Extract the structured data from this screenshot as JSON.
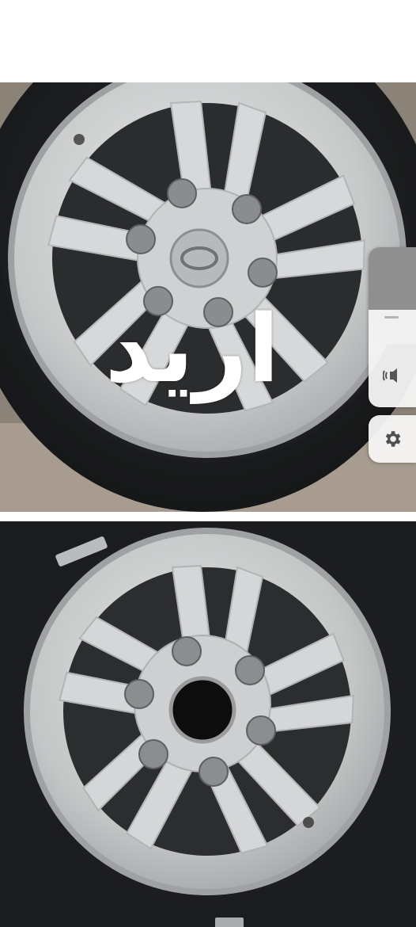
{
  "overlay": {
    "text": "اريد",
    "color": "#ffffff"
  },
  "volume_panel": {
    "level": 0.35,
    "sound_icon": "speaker-vibrate-icon"
  },
  "settings": {
    "icon": "gear-icon"
  },
  "photos": [
    {
      "subject": "hyundai-alloy-wheel-with-center-cap"
    },
    {
      "subject": "alloy-wheel-without-center-cap"
    }
  ],
  "colors": {
    "rim": "#c9cbcc",
    "tire": "#1f2123",
    "panel": "#f4f4f4",
    "track": "#8f8f8f"
  }
}
